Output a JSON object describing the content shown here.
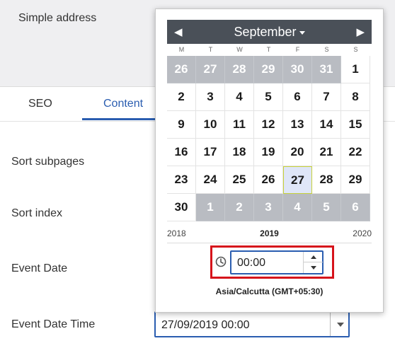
{
  "form": {
    "simple_address_label": "Simple address",
    "tabs": [
      {
        "label": "SEO",
        "active": false
      },
      {
        "label": "Content",
        "active": true
      }
    ],
    "fields": {
      "sort_subpages": "Sort subpages",
      "sort_index": "Sort index",
      "event_date": "Event Date",
      "event_date_time": "Event Date Time"
    },
    "event_date_time_value": "27/09/2019 00:00"
  },
  "datepicker": {
    "month": "September",
    "prev_icon": "chevron-left-icon",
    "next_icon": "chevron-right-icon",
    "weekdays": [
      "M",
      "T",
      "W",
      "T",
      "F",
      "S",
      "S"
    ],
    "weeks": [
      [
        {
          "d": "26",
          "other": true
        },
        {
          "d": "27",
          "other": true
        },
        {
          "d": "28",
          "other": true
        },
        {
          "d": "29",
          "other": true
        },
        {
          "d": "30",
          "other": true
        },
        {
          "d": "31",
          "other": true
        },
        {
          "d": "1",
          "other": false
        }
      ],
      [
        {
          "d": "2",
          "other": false
        },
        {
          "d": "3",
          "other": false
        },
        {
          "d": "4",
          "other": false
        },
        {
          "d": "5",
          "other": false
        },
        {
          "d": "6",
          "other": false
        },
        {
          "d": "7",
          "other": false
        },
        {
          "d": "8",
          "other": false
        }
      ],
      [
        {
          "d": "9",
          "other": false
        },
        {
          "d": "10",
          "other": false
        },
        {
          "d": "11",
          "other": false
        },
        {
          "d": "12",
          "other": false
        },
        {
          "d": "13",
          "other": false
        },
        {
          "d": "14",
          "other": false
        },
        {
          "d": "15",
          "other": false
        }
      ],
      [
        {
          "d": "16",
          "other": false
        },
        {
          "d": "17",
          "other": false
        },
        {
          "d": "18",
          "other": false
        },
        {
          "d": "19",
          "other": false
        },
        {
          "d": "20",
          "other": false
        },
        {
          "d": "21",
          "other": false
        },
        {
          "d": "22",
          "other": false
        }
      ],
      [
        {
          "d": "23",
          "other": false
        },
        {
          "d": "24",
          "other": false
        },
        {
          "d": "25",
          "other": false
        },
        {
          "d": "26",
          "other": false
        },
        {
          "d": "27",
          "other": false,
          "selected": true
        },
        {
          "d": "28",
          "other": false
        },
        {
          "d": "29",
          "other": false
        }
      ],
      [
        {
          "d": "30",
          "other": false
        },
        {
          "d": "1",
          "other": true
        },
        {
          "d": "2",
          "other": true
        },
        {
          "d": "3",
          "other": true
        },
        {
          "d": "4",
          "other": true
        },
        {
          "d": "5",
          "other": true
        },
        {
          "d": "6",
          "other": true
        }
      ]
    ],
    "year_prev": "2018",
    "year_current": "2019",
    "year_next": "2020",
    "time_value": "00:00",
    "timezone": "Asia/Calcutta (GMT+05:30)"
  },
  "colors": {
    "accent": "#2a5db0",
    "header_bg": "#4a5058",
    "other_month_bg": "#b9bcc2",
    "selected_bg": "#dfe6f8",
    "highlight_red": "#d6131b"
  }
}
